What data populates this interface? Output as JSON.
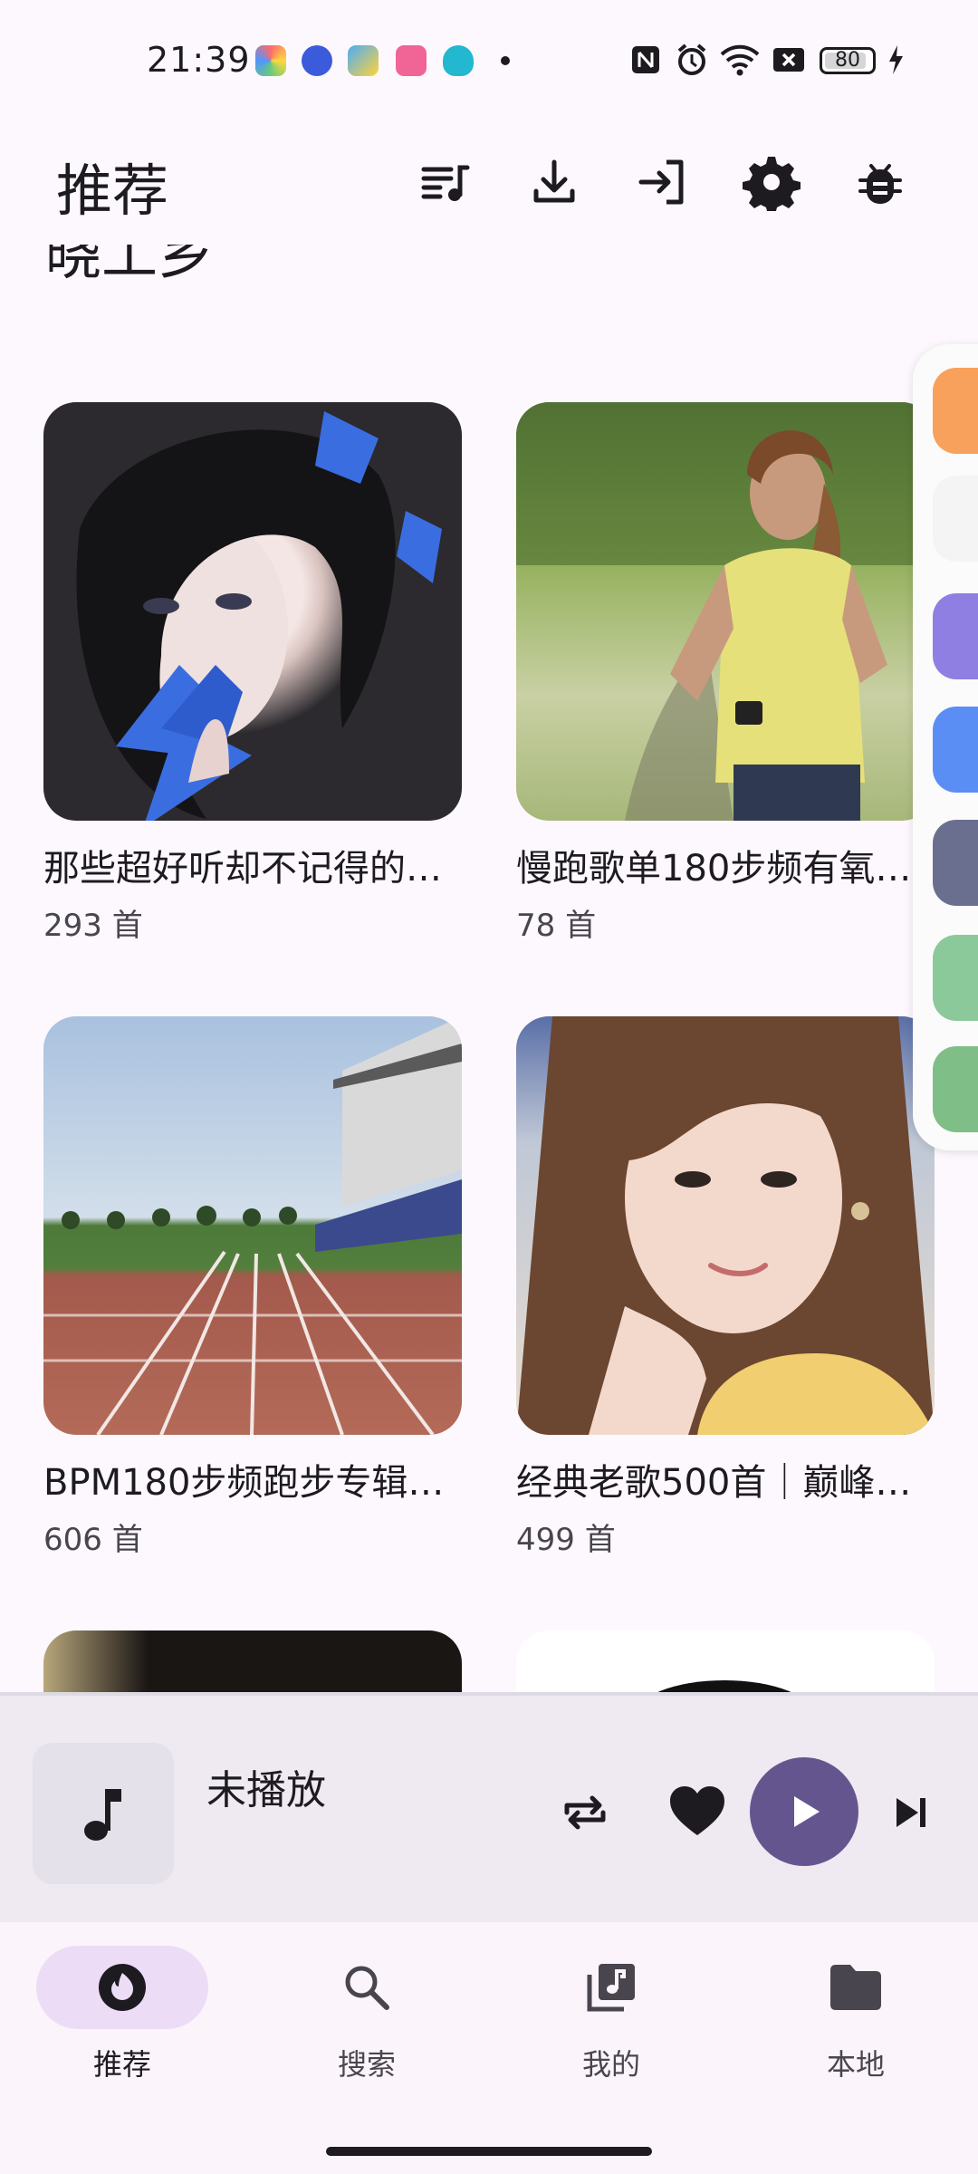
{
  "status_bar": {
    "time": "21:39",
    "battery": "80"
  },
  "header": {
    "title": "推荐",
    "icons": [
      "playlist-icon",
      "download-icon",
      "login-icon",
      "gear-icon",
      "bug-icon"
    ]
  },
  "section_cut_title": "晓工乡",
  "playlists": [
    {
      "title": "那些超好听却不记得的…",
      "count": "293 首",
      "image": "portrait-blue-flowers"
    },
    {
      "title": "慢跑歌单180步频有氧…",
      "count": "78 首",
      "image": "woman-jogging"
    },
    {
      "title": "BPM180步频跑步专辑…",
      "count": "606 首",
      "image": "running-track"
    },
    {
      "title": "经典老歌500首｜巅峰…",
      "count": "499 首",
      "image": "smiling-woman-portrait"
    }
  ],
  "player": {
    "status": "未播放"
  },
  "nav": {
    "items": [
      {
        "label": "推荐",
        "icon": "recommend-icon",
        "active": true
      },
      {
        "label": "搜索",
        "icon": "search-icon",
        "active": false
      },
      {
        "label": "我的",
        "icon": "library-icon",
        "active": false
      },
      {
        "label": "本地",
        "icon": "folder-icon",
        "active": false
      }
    ]
  },
  "colors": {
    "accent": "#65558f",
    "nav_active_pill": "#eddcf6",
    "background": "#fdf8fd",
    "player_bg": "#efe9f1"
  }
}
